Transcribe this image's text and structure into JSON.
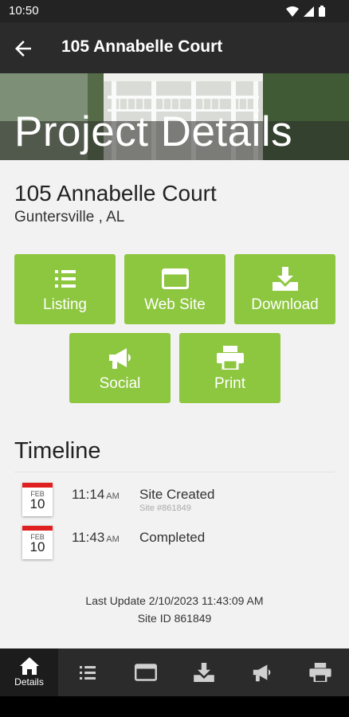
{
  "status_bar": {
    "time": "10:50"
  },
  "app_bar": {
    "title": "105 Annabelle Court"
  },
  "hero": {
    "title": "Project Details"
  },
  "property": {
    "address": "105 Annabelle Court",
    "city": "Guntersville , AL"
  },
  "actions": [
    {
      "label": "Listing",
      "icon": "list-icon"
    },
    {
      "label": "Web Site",
      "icon": "browser-window-icon"
    },
    {
      "label": "Download",
      "icon": "download-icon"
    },
    {
      "label": "Social",
      "icon": "megaphone-icon"
    },
    {
      "label": "Print",
      "icon": "printer-icon"
    }
  ],
  "timeline": {
    "title": "Timeline",
    "events": [
      {
        "month": "FEB",
        "day": "10",
        "time": "11:14",
        "ampm": "AM",
        "event": "Site Created",
        "sub": "Site #861849"
      },
      {
        "month": "FEB",
        "day": "10",
        "time": "11:43",
        "ampm": "AM",
        "event": "Completed",
        "sub": ""
      }
    ]
  },
  "footer": {
    "last_update": "Last Update 2/10/2023 11:43:09 AM",
    "site_id": "Site ID 861849"
  },
  "bottom_nav": {
    "items": [
      {
        "label": "Details",
        "icon": "home-icon",
        "active": true
      },
      {
        "label": "",
        "icon": "list-icon"
      },
      {
        "label": "",
        "icon": "browser-window-icon"
      },
      {
        "label": "",
        "icon": "download-icon"
      },
      {
        "label": "",
        "icon": "megaphone-icon"
      },
      {
        "label": "",
        "icon": "printer-icon"
      }
    ]
  },
  "colors": {
    "accent": "#8dc63f",
    "app_bar": "#2b2b2b",
    "calendar_red": "#e02020"
  }
}
